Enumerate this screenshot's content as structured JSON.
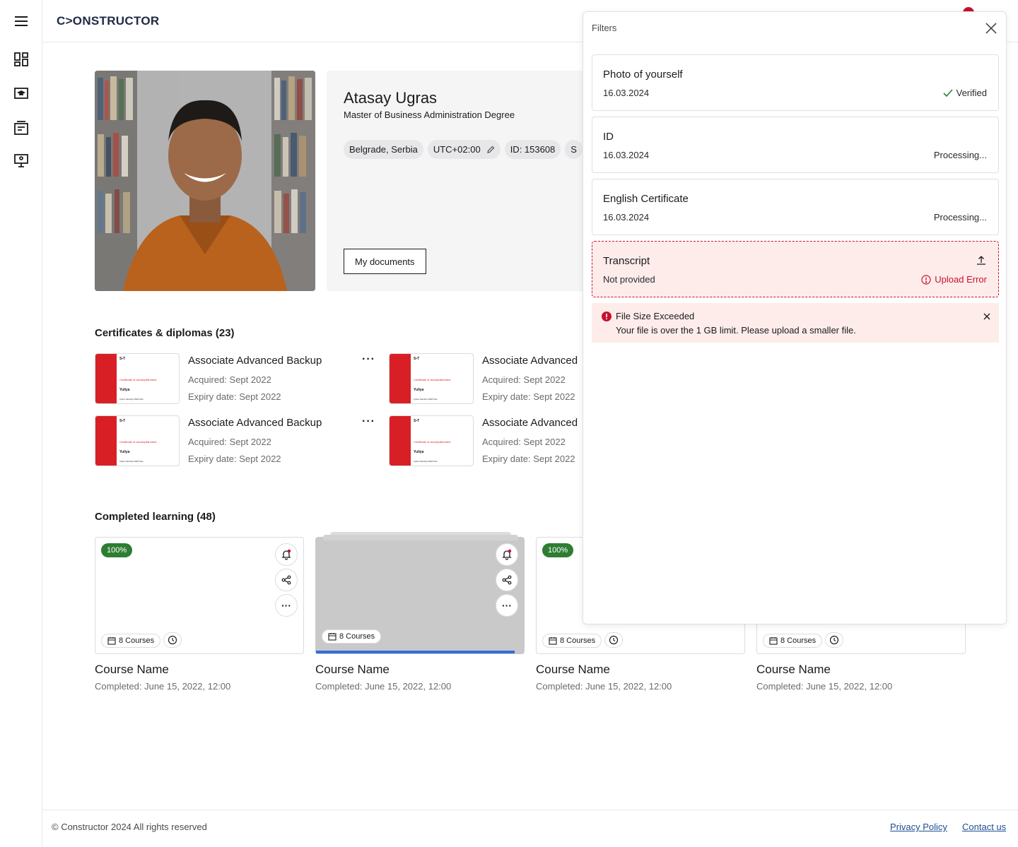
{
  "header": {
    "logo": "C>ONSTRUCTOR"
  },
  "profile": {
    "name": "Atasay Ugras",
    "degree": "Master of Business Administration Degree",
    "location": "Belgrade, Serbia",
    "timezone": "UTC+02:00",
    "id_label": "ID: 153608",
    "chip_cut": "S",
    "documents_button": "My documents"
  },
  "certificates": {
    "title": "Certificates & diplomas (23)",
    "thumb": {
      "brand": "S▪T",
      "heading": "Certificate of accomplishment",
      "recipient": "Yuliya",
      "course": "Cyber Security 2022 Test"
    },
    "items": [
      {
        "title": "Associate Advanced Backup",
        "acquired": "Acquired: Sept 2022",
        "expiry": "Expiry date: Sept 2022"
      },
      {
        "title": "Associate Advanced",
        "acquired": "Acquired: Sept 2022",
        "expiry": "Expiry date: Sept 2022"
      },
      {
        "title": "Associate Advanced Backup",
        "acquired": "Acquired: Sept 2022",
        "expiry": "Expiry date: Sept 2022"
      },
      {
        "title": "Associate Advanced",
        "acquired": "Acquired: Sept 2022",
        "expiry": "Expiry date: Sept 2022"
      }
    ]
  },
  "learning": {
    "title": "Completed learning (48)",
    "courses": [
      {
        "badge": "100%",
        "courses_label": "8 Courses",
        "name": "Course Name",
        "completed": "Completed: June 15, 2022, 12:00"
      },
      {
        "badge": "",
        "courses_label": "8 Courses",
        "name": "Course Name",
        "completed": "Completed: June 15, 2022, 12:00",
        "progress": 0.95
      },
      {
        "badge": "100%",
        "courses_label": "8 Courses",
        "name": "Course Name",
        "completed": "Completed: June 15, 2022, 12:00"
      },
      {
        "badge": "",
        "courses_label": "8 Courses",
        "name": "Course Name",
        "completed": "Completed: June 15, 2022, 12:00"
      }
    ]
  },
  "footer": {
    "copyright": "© Constructor 2024 All rights reserved",
    "privacy": "Privacy Policy",
    "contact": "Contact us"
  },
  "filters": {
    "title": "Filters",
    "documents": [
      {
        "name": "Photo of yourself",
        "date": "16.03.2024",
        "status": "Verified"
      },
      {
        "name": "ID",
        "date": "16.03.2024",
        "status": "Processing..."
      },
      {
        "name": "English Certificate",
        "date": "16.03.2024",
        "status": "Processing..."
      },
      {
        "name": "Transcript",
        "date": "Not provided",
        "status": "Upload Error"
      }
    ],
    "alert": {
      "title": "File Size Exceeded",
      "message": "Your file is over the 1 GB limit. Please upload a smaller file."
    }
  },
  "colors": {
    "accent_red": "#c8102e",
    "success_green": "#2e7d32",
    "progress_blue": "#2f6fde"
  }
}
